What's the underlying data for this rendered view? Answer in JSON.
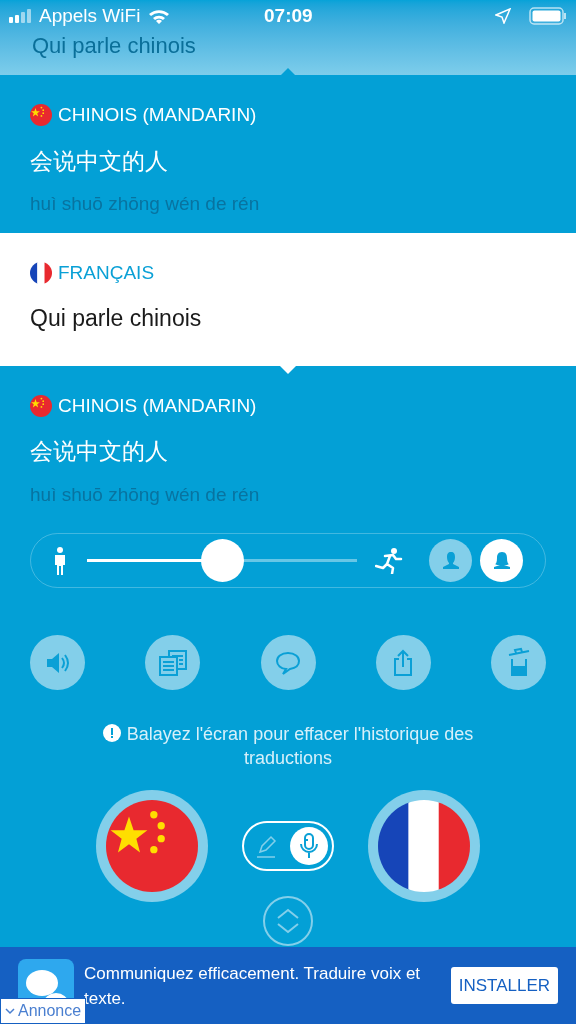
{
  "status_bar": {
    "carrier": "Appels WiFi",
    "time": "07:09"
  },
  "faded_header": {
    "text": "Qui parle chinois"
  },
  "entries": [
    {
      "kind": "china",
      "language": "CHINOIS (MANDARIN)",
      "text": "会说中文的人",
      "pinyin": "huì shuō zhōng wén de rén",
      "selected": false
    },
    {
      "kind": "france",
      "language": "FRANÇAIS",
      "text": "Qui parle chinois",
      "selected": true
    },
    {
      "kind": "china",
      "language": "CHINOIS (MANDARIN)",
      "text": "会说中文的人",
      "pinyin": "huì shuō zhōng wén de rén",
      "selected": false
    }
  ],
  "speed_slider": {
    "level": 0.5
  },
  "voices": [
    {
      "kind": "male",
      "selected": false
    },
    {
      "kind": "female",
      "selected": true
    }
  ],
  "actions": [
    {
      "kind": "speaker"
    },
    {
      "kind": "copy"
    },
    {
      "kind": "speech"
    },
    {
      "kind": "share"
    },
    {
      "kind": "trash"
    }
  ],
  "hint": "Balayez l'écran pour effacer l'historique des traductions",
  "language_buttons": [
    {
      "kind": "china"
    },
    {
      "kind": "france"
    }
  ],
  "input_modes": [
    {
      "kind": "pen",
      "selected": false
    },
    {
      "kind": "mic",
      "selected": true
    }
  ],
  "ad": {
    "text": "Communiquez efficacement. Traduire voix et texte.",
    "button": "INSTALLER",
    "label": "Annonce"
  }
}
